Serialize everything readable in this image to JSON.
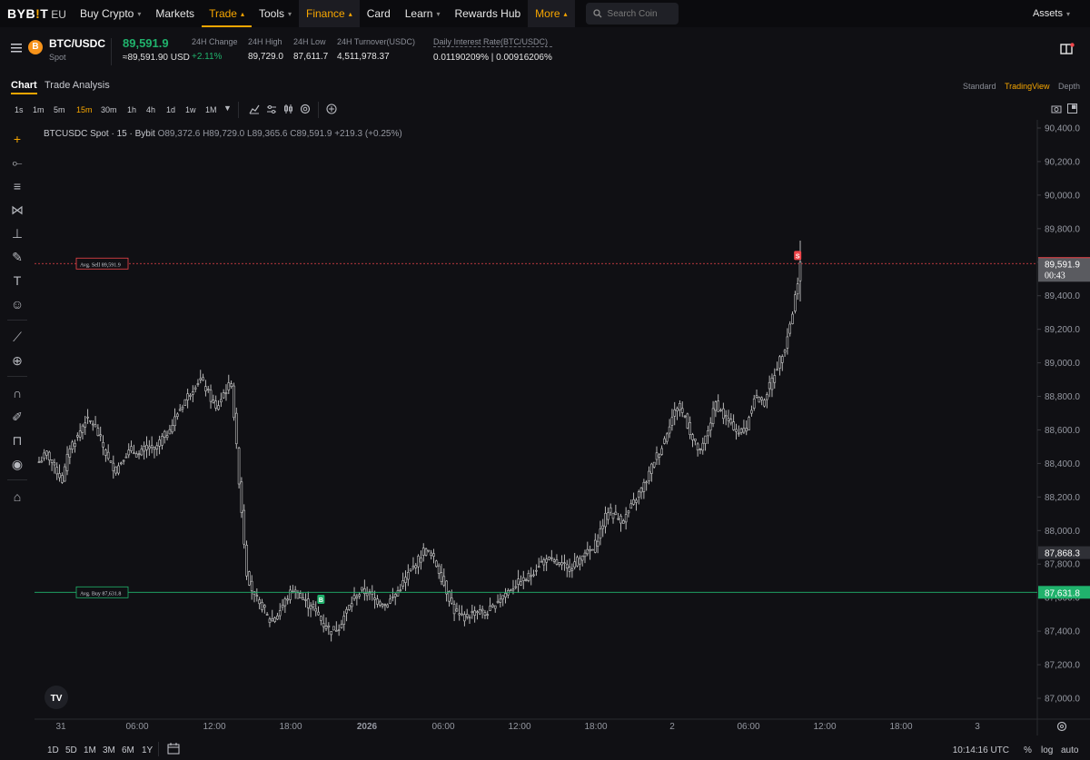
{
  "nav": {
    "brand": "BYB",
    "brand_dot": "!",
    "brand_end": "T",
    "region": "EU",
    "items": [
      {
        "label": "Buy Crypto",
        "caret": "⌵"
      },
      {
        "label": "Markets",
        "caret": ""
      },
      {
        "label": "Trade",
        "caret": "^"
      },
      {
        "label": "Tools",
        "caret": "⌵"
      },
      {
        "label": "Finance",
        "caret": "^"
      },
      {
        "label": "Card",
        "caret": ""
      },
      {
        "label": "Learn",
        "caret": "⌵"
      },
      {
        "label": "Rewards Hub",
        "caret": ""
      },
      {
        "label": "More",
        "caret": "^"
      }
    ],
    "search_placeholder": "Search Coin",
    "assets": "Assets"
  },
  "ticker": {
    "pair": "BTC/USDC",
    "market": "Spot",
    "coin_glyph": "B",
    "last_price": "89,591.9",
    "last_price_fiat": "≈89,591.90 USD",
    "stats": [
      {
        "label": "24H Change",
        "value": "+2.11%"
      },
      {
        "label": "24H High",
        "value": "89,729.0"
      },
      {
        "label": "24H Low",
        "value": "87,611.7"
      },
      {
        "label": "24H Turnover(USDC)",
        "value": "4,511,978.37"
      },
      {
        "label": "Daily Interest Rate(BTC/USDC)",
        "value": "0.01190209% | 0.00916206%"
      }
    ]
  },
  "tabs": {
    "chart": "Chart",
    "trade_analysis": "Trade Analysis",
    "views": [
      "Standard",
      "TradingView",
      "Depth"
    ]
  },
  "timeframes": [
    "1s",
    "1m",
    "5m",
    "15m",
    "30m",
    "1h",
    "4h",
    "1d",
    "1w",
    "1M"
  ],
  "active_timeframe": "15m",
  "legend": {
    "symbol": "BTCUSDC Spot · 15 · Bybit",
    "ohlc": "O89,372.6 H89,729.0 L89,365.6 C89,591.9 +219.3 (+0.25%)"
  },
  "bottom": {
    "ranges": [
      "1D",
      "5D",
      "1M",
      "3M",
      "6M",
      "1Y"
    ],
    "time": "10:14:16 UTC",
    "options": [
      "%",
      "log",
      "auto"
    ]
  },
  "colors": {
    "accent": "#f7a600",
    "up": "#20b26c",
    "down": "#ef454a",
    "background": "#101014",
    "candle": "#c9c9c9"
  },
  "chart_data": {
    "type": "candlestick",
    "symbol": "BTCUSDC Spot",
    "interval": "15",
    "ylim": [
      86900,
      90450
    ],
    "y_ticks": [
      "90,400.0",
      "90,200.0",
      "90,000.0",
      "89,800.0",
      "89,600.0",
      "89,400.0",
      "89,200.0",
      "89,000.0",
      "88,800.0",
      "88,600.0",
      "88,400.0",
      "88,200.0",
      "88,000.0",
      "87,800.0",
      "87,600.0",
      "87,400.0",
      "87,200.0",
      "87,000.0"
    ],
    "x_ticks": [
      "31",
      "06:00",
      "12:00",
      "18:00",
      "2026",
      "06:00",
      "12:00",
      "18:00",
      "2",
      "06:00",
      "12:00",
      "18:00",
      "3"
    ],
    "close_path": [
      [
        0,
        88410
      ],
      [
        3,
        88460
      ],
      [
        6,
        88380
      ],
      [
        9,
        88300
      ],
      [
        12,
        88500
      ],
      [
        15,
        88560
      ],
      [
        18,
        88660
      ],
      [
        21,
        88640
      ],
      [
        24,
        88540
      ],
      [
        27,
        88420
      ],
      [
        30,
        88360
      ],
      [
        33,
        88440
      ],
      [
        36,
        88480
      ],
      [
        39,
        88450
      ],
      [
        42,
        88500
      ],
      [
        45,
        88480
      ],
      [
        48,
        88550
      ],
      [
        51,
        88600
      ],
      [
        54,
        88700
      ],
      [
        57,
        88780
      ],
      [
        60,
        88850
      ],
      [
        63,
        88900
      ],
      [
        66,
        88820
      ],
      [
        69,
        88720
      ],
      [
        72,
        88820
      ],
      [
        75,
        88880
      ],
      [
        78,
        88300
      ],
      [
        81,
        87750
      ],
      [
        84,
        87600
      ],
      [
        87,
        87550
      ],
      [
        90,
        87460
      ],
      [
        93,
        87500
      ],
      [
        96,
        87580
      ],
      [
        99,
        87650
      ],
      [
        102,
        87600
      ],
      [
        105,
        87560
      ],
      [
        108,
        87520
      ],
      [
        111,
        87440
      ],
      [
        114,
        87400
      ],
      [
        117,
        87430
      ],
      [
        120,
        87520
      ],
      [
        123,
        87600
      ],
      [
        126,
        87640
      ],
      [
        129,
        87620
      ],
      [
        132,
        87580
      ],
      [
        135,
        87560
      ],
      [
        138,
        87600
      ],
      [
        141,
        87660
      ],
      [
        144,
        87740
      ],
      [
        147,
        87800
      ],
      [
        150,
        87880
      ],
      [
        153,
        87860
      ],
      [
        156,
        87760
      ],
      [
        159,
        87640
      ],
      [
        162,
        87520
      ],
      [
        165,
        87480
      ],
      [
        168,
        87500
      ],
      [
        171,
        87520
      ],
      [
        174,
        87500
      ],
      [
        177,
        87540
      ],
      [
        180,
        87600
      ],
      [
        183,
        87640
      ],
      [
        186,
        87680
      ],
      [
        189,
        87700
      ],
      [
        192,
        87740
      ],
      [
        195,
        87800
      ],
      [
        198,
        87830
      ],
      [
        201,
        87810
      ],
      [
        204,
        87790
      ],
      [
        207,
        87780
      ],
      [
        210,
        87820
      ],
      [
        213,
        87860
      ],
      [
        216,
        87880
      ],
      [
        219,
        88000
      ],
      [
        222,
        88120
      ],
      [
        225,
        88080
      ],
      [
        228,
        88060
      ],
      [
        231,
        88140
      ],
      [
        234,
        88220
      ],
      [
        237,
        88300
      ],
      [
        240,
        88420
      ],
      [
        243,
        88500
      ],
      [
        246,
        88640
      ],
      [
        249,
        88740
      ],
      [
        252,
        88680
      ],
      [
        255,
        88540
      ],
      [
        258,
        88460
      ],
      [
        261,
        88600
      ],
      [
        264,
        88760
      ],
      [
        267,
        88680
      ],
      [
        270,
        88640
      ],
      [
        273,
        88580
      ],
      [
        276,
        88620
      ],
      [
        279,
        88800
      ],
      [
        282,
        88760
      ],
      [
        285,
        88860
      ],
      [
        288,
        88980
      ],
      [
        291,
        89100
      ],
      [
        294,
        89300
      ],
      [
        297,
        89591.9
      ]
    ],
    "last_candle": {
      "open": 89372.6,
      "high": 89729.0,
      "low": 89365.6,
      "close": 89591.9
    },
    "price_lines": [
      {
        "label": "Avg. Sell 89,591.9",
        "value": 89591.9,
        "axis_label": "89,591.9",
        "color": "#ef454a"
      },
      {
        "label": "Avg. Buy 87,631.8",
        "value": 87631.8,
        "axis_label": "87,631.8",
        "color": "#20b26c"
      }
    ],
    "axis_badges": [
      {
        "label": "89,591.9",
        "sub": "00:43",
        "value": 89591.9
      },
      {
        "label": "87,868.3",
        "value": 87868.3
      }
    ],
    "markers": [
      {
        "text": "S",
        "x_index": 296,
        "value": 89640,
        "color": "#ef454a"
      },
      {
        "text": "B",
        "x_index": 110,
        "value": 87590,
        "color": "#20b26c"
      }
    ]
  }
}
